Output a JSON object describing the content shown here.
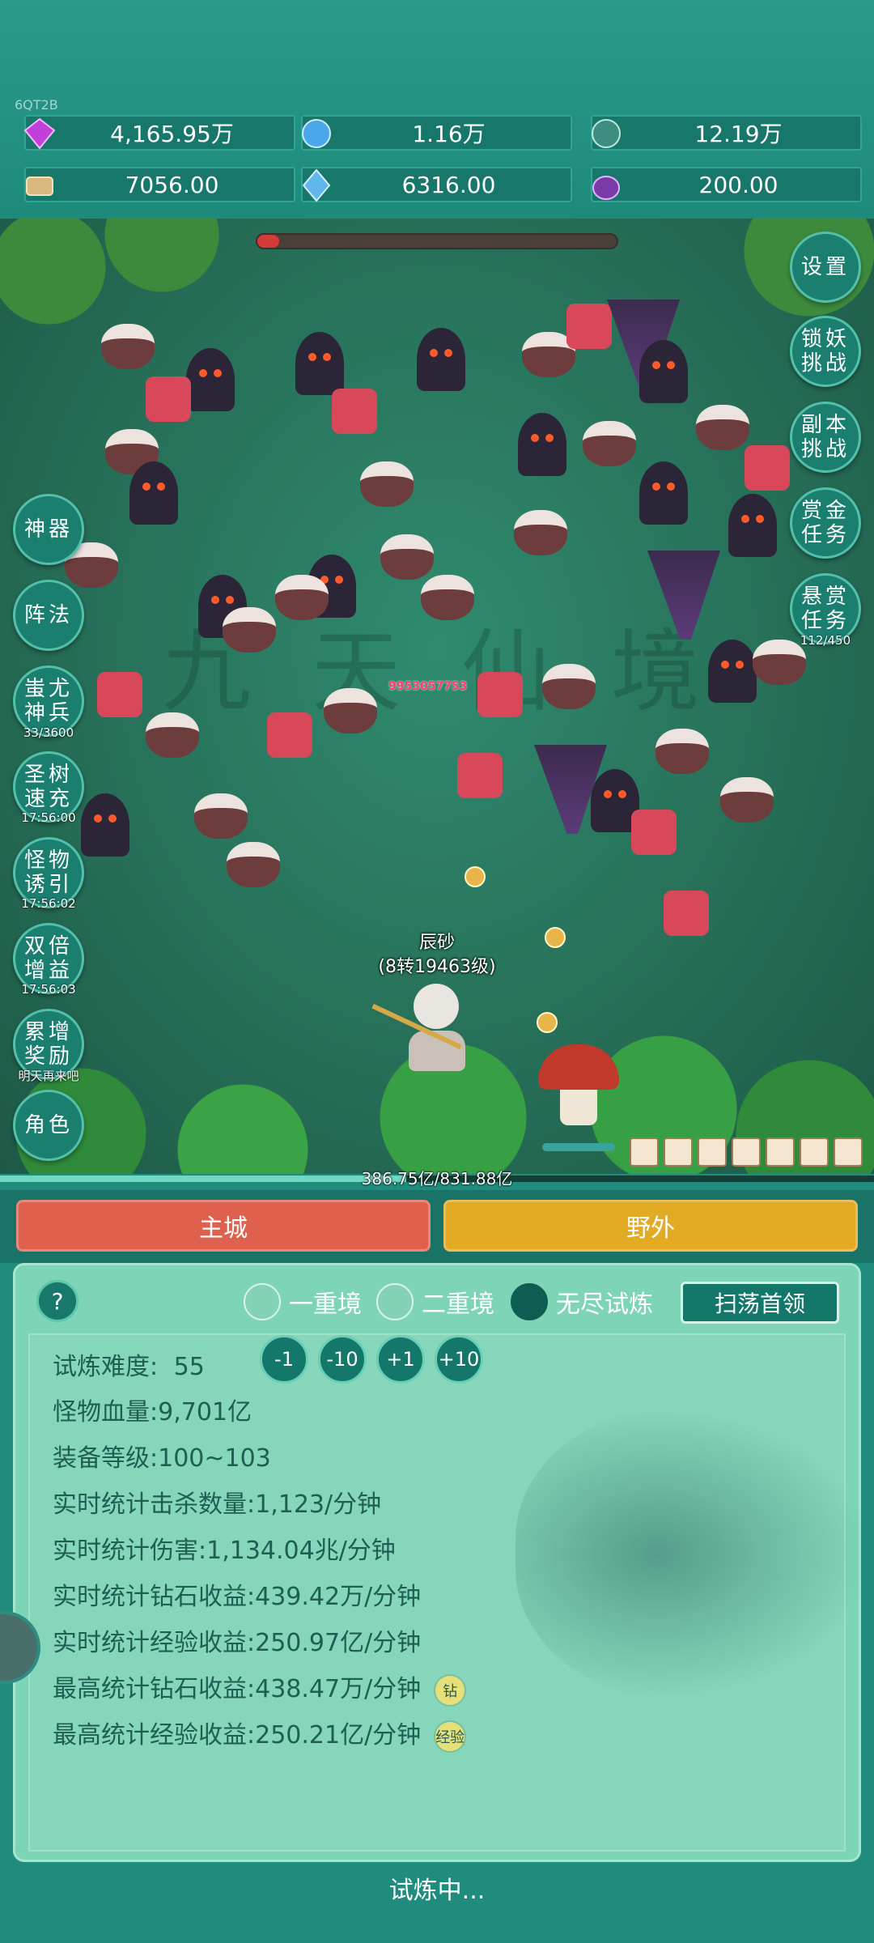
{
  "build_tag": "6QT2B",
  "resources": [
    {
      "icon": "purple-gem-icon",
      "value": "4,165.95万"
    },
    {
      "icon": "blue-crystal-icon",
      "value": "1.16万"
    },
    {
      "icon": "teal-orb-icon",
      "value": "12.19万"
    },
    {
      "icon": "scroll-icon",
      "value": "7056.00"
    },
    {
      "icon": "ice-shard-icon",
      "value": "6316.00"
    },
    {
      "icon": "purple-pouch-icon",
      "value": "200.00"
    }
  ],
  "right_menu": {
    "settings": "设置",
    "demon_challenge": "锁妖挑战",
    "dungeon_challenge": "副本挑战",
    "gold_task": "赏金任务",
    "bounty_task": "悬赏任务",
    "bounty_progress": "112/450"
  },
  "left_menu": {
    "artifact": "神器",
    "formation": "阵法",
    "chiyou_soldiers": "蚩尤神兵",
    "chiyou_progress": "33/3600",
    "holy_tree": "圣树速充",
    "holy_tree_timer": "17:56:00",
    "monster_lure": "怪物诱引",
    "monster_lure_timer": "17:56:02",
    "double_gain": "双倍增益",
    "double_gain_timer": "17:56:03",
    "accum_reward": "累增奖励",
    "accum_reward_note": "明天再来吧",
    "character": "角色"
  },
  "battle": {
    "damage_number": "9953057753",
    "hero_name": "辰砂",
    "hero_level": "(8转19463级)",
    "boss_hp_fraction": 0.06,
    "exp_text": "386.75亿/831.88亿",
    "exp_fraction": 0.465
  },
  "tabs": {
    "city": "主城",
    "wild": "野外"
  },
  "panel": {
    "help": "?",
    "modes": [
      {
        "label": "一重境",
        "selected": false
      },
      {
        "label": "二重境",
        "selected": false
      },
      {
        "label": "无尽试炼",
        "selected": true
      }
    ],
    "sweep_button": "扫荡首领",
    "difficulty_label": "试炼难度:",
    "difficulty_value": "55",
    "steps": [
      "-1",
      "-10",
      "+1",
      "+10"
    ],
    "stats": [
      "怪物血量:9,701亿",
      "装备等级:100~103",
      "实时统计击杀数量:1,123/分钟",
      "实时统计伤害:1,134.04兆/分钟",
      "实时统计钻石收益:439.42万/分钟",
      "实时统计经验收益:250.97亿/分钟",
      "最高统计钻石收益:438.47万/分钟",
      "最高统计经验收益:250.21亿/分钟"
    ],
    "badge_diamond": "钻",
    "badge_exp": "经验"
  },
  "status_text": "试炼中..."
}
